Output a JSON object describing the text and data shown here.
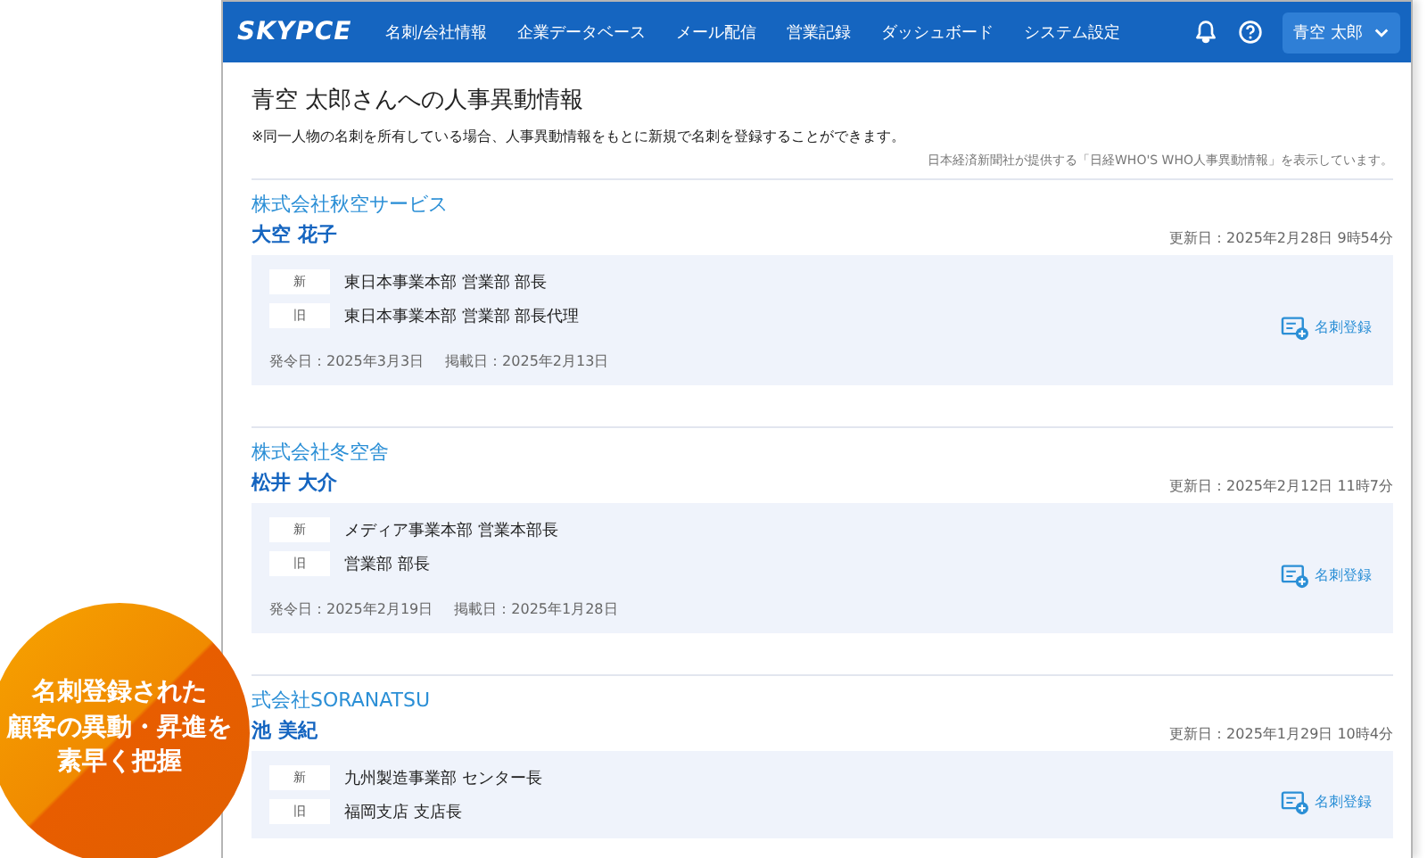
{
  "header": {
    "logo": "SKYPCE",
    "nav": [
      "名刺/会社情報",
      "企業データベース",
      "メール配信",
      "営業記録",
      "ダッシュボード",
      "システム設定"
    ],
    "user": "青空 太郎"
  },
  "page": {
    "title": "青空 太郎さんへの人事異動情報",
    "note": "※同一人物の名刺を所有している場合、人事異動情報をもとに新規で名刺を登録することができます。",
    "source": "日本経済新聞社が提供する「日経WHO'S WHO人事異動情報」を表示しています。"
  },
  "entries": [
    {
      "company": "株式会社秋空サービス",
      "name": "大空 花子",
      "updated": "更新日：2025年2月28日 9時54分",
      "changes": [
        {
          "tag": "新",
          "text": "東日本事業本部 営業部 部長"
        },
        {
          "tag": "旧",
          "text": "東日本事業本部 営業部 部長代理"
        }
      ],
      "issued": "発令日：2025年3月3日",
      "published": "掲載日：2025年2月13日",
      "action": "名刺登録"
    },
    {
      "company": "株式会社冬空舎",
      "name": "松井 大介",
      "updated": "更新日：2025年2月12日 11時7分",
      "changes": [
        {
          "tag": "新",
          "text": "メディア事業本部 営業本部長"
        },
        {
          "tag": "旧",
          "text": "営業部 部長"
        }
      ],
      "issued": "発令日：2025年2月19日",
      "published": "掲載日：2025年1月28日",
      "action": "名刺登録"
    },
    {
      "company": "式会社SORANATSU",
      "name": "池 美紀",
      "updated": "更新日：2025年1月29日 10時4分",
      "changes": [
        {
          "tag": "新",
          "text": "九州製造事業部 センター長"
        },
        {
          "tag": "旧",
          "text": "福岡支店 支店長"
        }
      ],
      "action": "名刺登録"
    }
  ],
  "badge": {
    "lines": [
      "名刺登録された",
      "顧客の異動・昇進を",
      "素早く把握"
    ]
  }
}
